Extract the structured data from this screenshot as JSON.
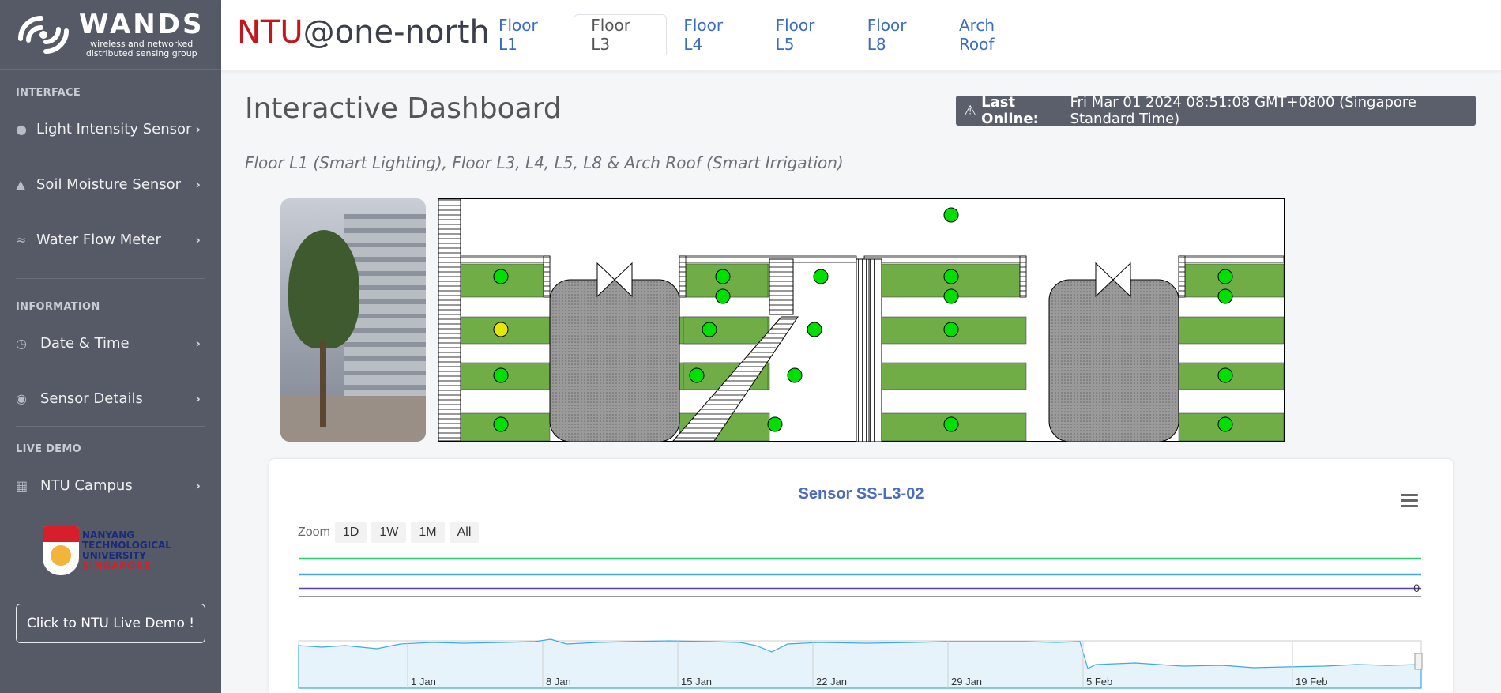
{
  "brand": {
    "name": "WANDS",
    "subtitle_line1": "wireless and networked",
    "subtitle_line2": "distributed sensing group"
  },
  "sidebar": {
    "section_interface": "INTERFACE",
    "section_information": "INFORMATION",
    "section_live_demo": "LIVE DEMO",
    "items": [
      {
        "label": "Light Intensity Sensor",
        "icon": "lightbulb-icon"
      },
      {
        "label": "Soil Moisture Sensor",
        "icon": "bell-icon"
      },
      {
        "label": "Water Flow Meter",
        "icon": "water-icon"
      },
      {
        "label": "Date & Time",
        "icon": "clock-icon"
      },
      {
        "label": "Sensor Details",
        "icon": "eye-icon"
      },
      {
        "label": "NTU Campus",
        "icon": "building-icon"
      }
    ],
    "ntu_logo": {
      "line1": "NANYANG",
      "line2": "TECHNOLOGICAL",
      "line3": "UNIVERSITY",
      "line4": "SINGAPORE"
    },
    "demo_button": "Click to NTU Live Demo !"
  },
  "header": {
    "title_part1": "NTU",
    "title_part2": "@one-north",
    "tabs": [
      "Floor L1",
      "Floor L3",
      "Floor L4",
      "Floor L5",
      "Floor L8",
      "Arch Roof"
    ],
    "active_tab": "Floor L3"
  },
  "main": {
    "page_title": "Interactive Dashboard",
    "online_label": "Last Online:",
    "online_value": "Fri Mar 01 2024 08:51:08 GMT+0800 (Singapore Standard Time)",
    "subtitle": "Floor L1 (Smart Lighting), Floor L3, L4, L5, L8 & Arch Roof (Smart Irrigation)"
  },
  "colors": {
    "sidebar": "#555a66",
    "accent_red": "#c4161c",
    "tab_blue": "#3b6cc4",
    "planter_green": "#70ad47",
    "sensor_green": "#00e000",
    "sensor_yellow": "#e6e600"
  },
  "chart": {
    "title": "Sensor SS-L3-02",
    "zoom_label": "Zoom",
    "zoom_buttons": [
      "1D",
      "1W",
      "1M",
      "All"
    ],
    "zero_label": "0",
    "navigator_dates": [
      "1 Jan",
      "8 Jan",
      "15 Jan",
      "22 Jan",
      "29 Jan",
      "5 Feb",
      "19 Feb"
    ]
  },
  "chart_data": {
    "type": "line",
    "title": "Sensor SS-L3-02",
    "series": [
      {
        "color": "#2ecc71",
        "values": []
      },
      {
        "color": "#3fa9e0",
        "values": []
      },
      {
        "color": "#5b3fb0",
        "values": []
      }
    ],
    "x_ticks": [
      "1 Jan",
      "8 Jan",
      "15 Jan",
      "22 Jan",
      "29 Jan",
      "5 Feb",
      "19 Feb"
    ],
    "y_tick": "0"
  }
}
